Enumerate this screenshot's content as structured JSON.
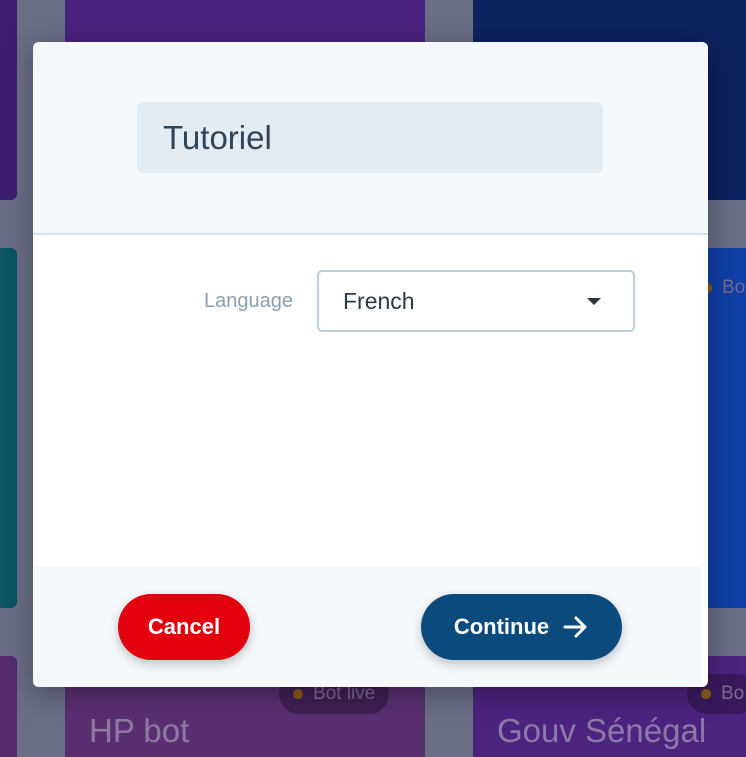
{
  "background": {
    "cards": [
      {
        "title": "HP bot",
        "badge": "Bot live"
      },
      {
        "title": "Gouv Sénégal",
        "badge": "Bo"
      }
    ],
    "right_card_badge": "Bo"
  },
  "modal": {
    "title_value": "Tutoriel",
    "language_label": "Language",
    "language_selected": "French",
    "cancel_label": "Cancel",
    "continue_label": "Continue"
  },
  "colors": {
    "cancel": "#e3000f",
    "continue": "#0b4a7c",
    "header_bg": "#f4f8fb"
  },
  "icons": {
    "caret": "caret-down-icon",
    "continue_arrow": "arrow-right-icon",
    "status_dot": "status-dot-icon"
  }
}
